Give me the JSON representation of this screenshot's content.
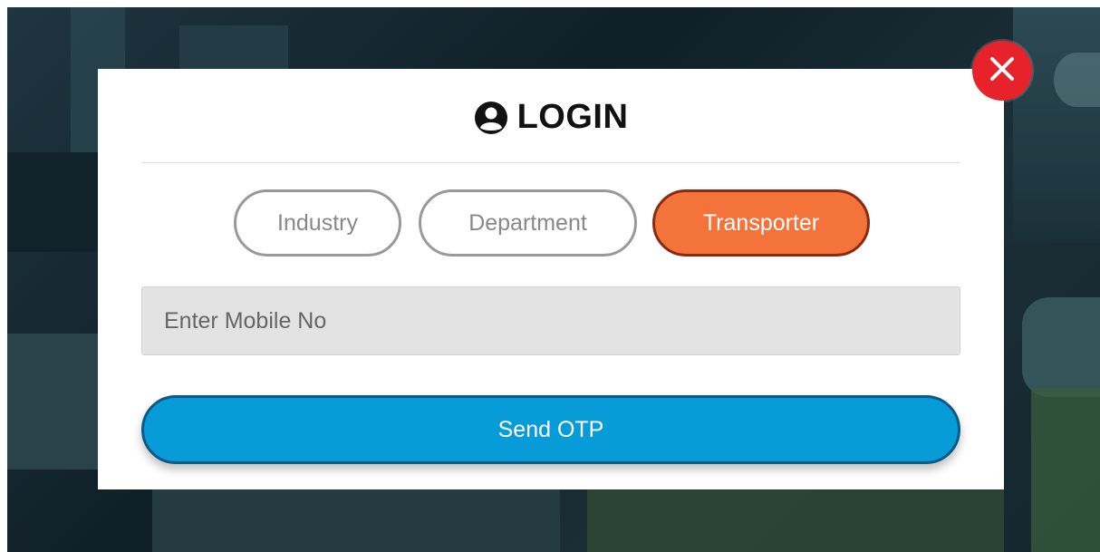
{
  "modal": {
    "title": "LOGIN",
    "title_icon": "user-circle-icon",
    "close_icon": "close-icon",
    "roles": [
      {
        "label": "Industry",
        "selected": false
      },
      {
        "label": "Department",
        "selected": false
      },
      {
        "label": "Transporter",
        "selected": true
      }
    ],
    "mobile_input": {
      "placeholder": "Enter Mobile No",
      "value": ""
    },
    "send_otp_label": "Send OTP"
  },
  "colors": {
    "selected_role_bg": "#f4733b",
    "send_button_bg": "#079bd7",
    "close_button_bg": "#e8222b"
  }
}
